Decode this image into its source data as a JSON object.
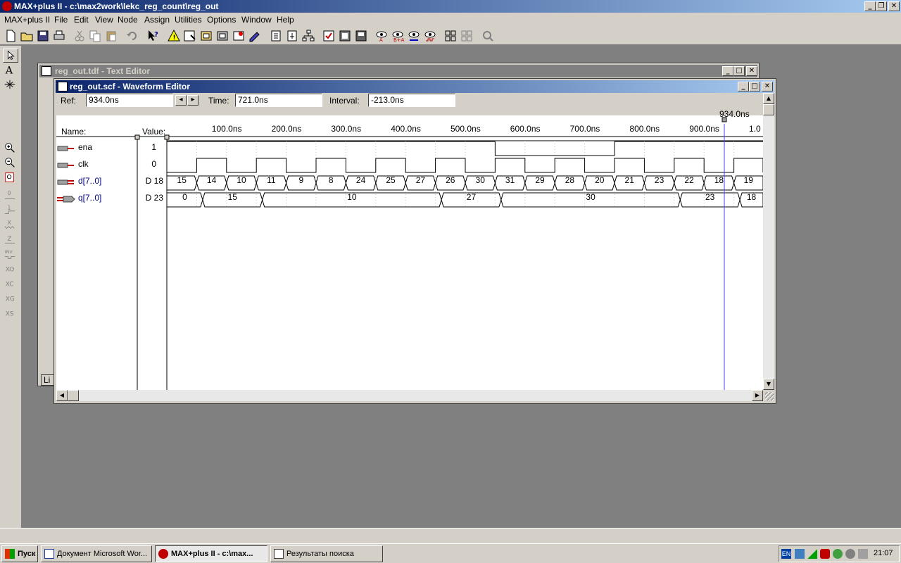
{
  "app": {
    "title": "MAX+plus II - c:\\max2work\\lekc_reg_count\\reg_out"
  },
  "menu": [
    "MAX+plus II",
    "File",
    "Edit",
    "View",
    "Node",
    "Assign",
    "Utilities",
    "Options",
    "Window",
    "Help"
  ],
  "text_editor": {
    "title": "reg_out.tdf - Text Editor",
    "tab_stub": "Li"
  },
  "waveform": {
    "title": "reg_out.scf - Waveform Editor",
    "ref_label": "Ref:",
    "ref_value": "934.0ns",
    "time_label": "Time:",
    "time_value": "721.0ns",
    "interval_label": "Interval:",
    "interval_value": "-213.0ns",
    "cursor_label": "934.0ns",
    "name_header": "Name:",
    "value_header": "Value:",
    "ticks": [
      "100.0ns",
      "200.0ns",
      "300.0ns",
      "400.0ns",
      "500.0ns",
      "600.0ns",
      "700.0ns",
      "800.0ns",
      "900.0ns",
      "1.0"
    ],
    "signals": [
      {
        "name": "ena",
        "value": "1"
      },
      {
        "name": "clk",
        "value": "0"
      },
      {
        "name": "d[7..0]",
        "value": "D 18"
      },
      {
        "name": "q[7..0]",
        "value": "D 23"
      }
    ],
    "d_bus": [
      "15",
      "14",
      "10",
      "11",
      "9",
      "8",
      "24",
      "25",
      "27",
      "26",
      "30",
      "31",
      "29",
      "28",
      "20",
      "21",
      "23",
      "22",
      "18",
      "19"
    ],
    "q_bus": [
      "0",
      "15",
      "10",
      "27",
      "30",
      "23",
      "18"
    ]
  },
  "taskbar": {
    "start": "Пуск",
    "items": [
      "Документ Microsoft Wor...",
      "MAX+plus II - c:\\max...",
      "Результаты поиска"
    ],
    "lang": "EN",
    "clock": "21:07"
  }
}
